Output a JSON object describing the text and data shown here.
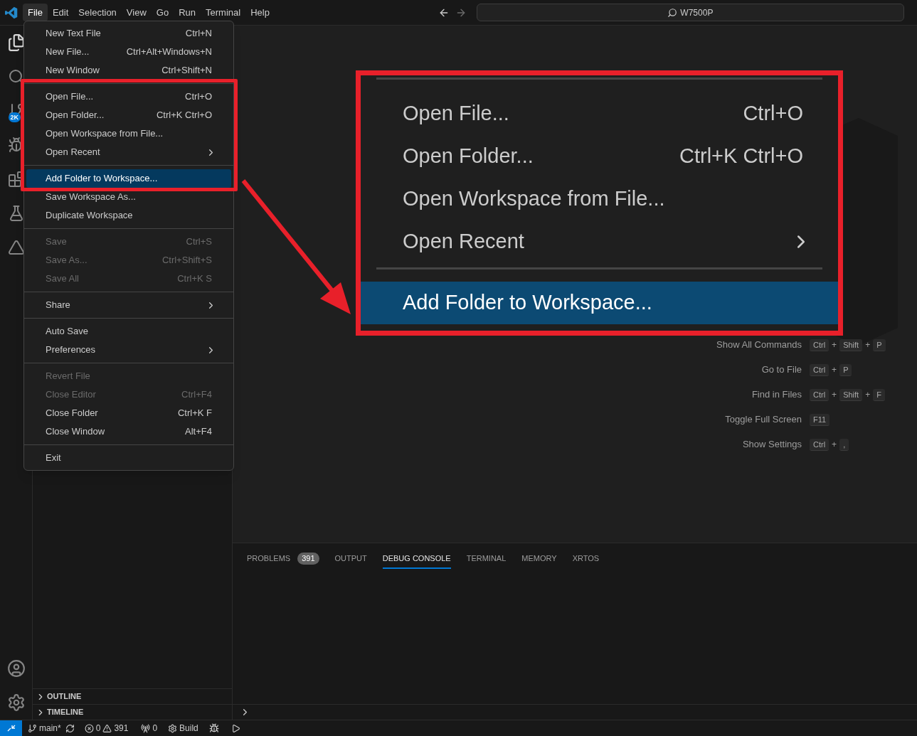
{
  "title_bar": {
    "menus": [
      {
        "label": "File",
        "selected": true
      },
      {
        "label": "Edit",
        "selected": false
      },
      {
        "label": "Selection",
        "selected": false
      },
      {
        "label": "View",
        "selected": false
      },
      {
        "label": "Go",
        "selected": false
      },
      {
        "label": "Run",
        "selected": false
      },
      {
        "label": "Terminal",
        "selected": false
      },
      {
        "label": "Help",
        "selected": false
      }
    ],
    "command_center": {
      "text": "W7500P"
    }
  },
  "activity_bar": {
    "source_control_badge": "2K"
  },
  "file_menu": {
    "groups": [
      [
        {
          "label": "New Text File",
          "shortcut": "Ctrl+N",
          "submenu": false,
          "disabled": false,
          "selected": false
        },
        {
          "label": "New File...",
          "shortcut": "Ctrl+Alt+Windows+N",
          "submenu": false,
          "disabled": false,
          "selected": false
        },
        {
          "label": "New Window",
          "shortcut": "Ctrl+Shift+N",
          "submenu": false,
          "disabled": false,
          "selected": false
        }
      ],
      [
        {
          "label": "Open File...",
          "shortcut": "Ctrl+O",
          "submenu": false,
          "disabled": false,
          "selected": false
        },
        {
          "label": "Open Folder...",
          "shortcut": "Ctrl+K Ctrl+O",
          "submenu": false,
          "disabled": false,
          "selected": false
        },
        {
          "label": "Open Workspace from File...",
          "submenu": false,
          "disabled": false,
          "selected": false
        },
        {
          "label": "Open Recent",
          "submenu": true,
          "disabled": false,
          "selected": false
        }
      ],
      [
        {
          "label": "Add Folder to Workspace...",
          "submenu": false,
          "disabled": false,
          "selected": true
        },
        {
          "label": "Save Workspace As...",
          "submenu": false,
          "disabled": false,
          "selected": false
        },
        {
          "label": "Duplicate Workspace",
          "submenu": false,
          "disabled": false,
          "selected": false
        }
      ],
      [
        {
          "label": "Save",
          "shortcut": "Ctrl+S",
          "submenu": false,
          "disabled": true,
          "selected": false
        },
        {
          "label": "Save As...",
          "shortcut": "Ctrl+Shift+S",
          "submenu": false,
          "disabled": true,
          "selected": false
        },
        {
          "label": "Save All",
          "shortcut": "Ctrl+K S",
          "submenu": false,
          "disabled": true,
          "selected": false
        }
      ],
      [
        {
          "label": "Share",
          "submenu": true,
          "disabled": false,
          "selected": false
        }
      ],
      [
        {
          "label": "Auto Save",
          "submenu": false,
          "disabled": false,
          "selected": false
        },
        {
          "label": "Preferences",
          "submenu": true,
          "disabled": false,
          "selected": false
        }
      ],
      [
        {
          "label": "Revert File",
          "submenu": false,
          "disabled": true,
          "selected": false
        },
        {
          "label": "Close Editor",
          "shortcut": "Ctrl+F4",
          "submenu": false,
          "disabled": true,
          "selected": false
        },
        {
          "label": "Close Folder",
          "shortcut": "Ctrl+K F",
          "submenu": false,
          "disabled": false,
          "selected": false
        },
        {
          "label": "Close Window",
          "shortcut": "Alt+F4",
          "submenu": false,
          "disabled": false,
          "selected": false
        }
      ],
      [
        {
          "label": "Exit",
          "submenu": false,
          "disabled": false,
          "selected": false
        }
      ]
    ]
  },
  "callout": {
    "groups": [
      [
        {
          "label": "Open File...",
          "shortcut": "Ctrl+O",
          "submenu": false,
          "selected": false
        },
        {
          "label": "Open Folder...",
          "shortcut": "Ctrl+K Ctrl+O",
          "submenu": false,
          "selected": false
        },
        {
          "label": "Open Workspace from File...",
          "submenu": false,
          "selected": false
        },
        {
          "label": "Open Recent",
          "submenu": true,
          "selected": false
        }
      ],
      [
        {
          "label": "Add Folder to Workspace...",
          "submenu": false,
          "selected": true
        }
      ]
    ]
  },
  "welcome_shortcuts": [
    {
      "label": "Show All Commands",
      "keys": [
        {
          "kind": "key",
          "text": "Ctrl"
        },
        {
          "kind": "plus",
          "text": "+"
        },
        {
          "kind": "key",
          "text": "Shift"
        },
        {
          "kind": "plus",
          "text": "+"
        },
        {
          "kind": "key",
          "text": "P"
        }
      ]
    },
    {
      "label": "Go to File",
      "keys": [
        {
          "kind": "key",
          "text": "Ctrl"
        },
        {
          "kind": "plus",
          "text": "+"
        },
        {
          "kind": "key",
          "text": "P"
        }
      ]
    },
    {
      "label": "Find in Files",
      "keys": [
        {
          "kind": "key",
          "text": "Ctrl"
        },
        {
          "kind": "plus",
          "text": "+"
        },
        {
          "kind": "key",
          "text": "Shift"
        },
        {
          "kind": "plus",
          "text": "+"
        },
        {
          "kind": "key",
          "text": "F"
        }
      ]
    },
    {
      "label": "Toggle Full Screen",
      "keys": [
        {
          "kind": "key",
          "text": "F11"
        }
      ]
    },
    {
      "label": "Show Settings",
      "keys": [
        {
          "kind": "key",
          "text": "Ctrl"
        },
        {
          "kind": "plus",
          "text": "+"
        },
        {
          "kind": "key",
          "text": ","
        }
      ]
    }
  ],
  "sidebar": {
    "sections": [
      {
        "label": "OUTLINE",
        "expanded": false
      },
      {
        "label": "TIMELINE",
        "expanded": false
      }
    ]
  },
  "panel": {
    "tabs": [
      {
        "label": "PROBLEMS",
        "badge": "391",
        "selected": false
      },
      {
        "label": "OUTPUT",
        "selected": false
      },
      {
        "label": "DEBUG CONSOLE",
        "selected": true
      },
      {
        "label": "TERMINAL",
        "selected": false
      },
      {
        "label": "MEMORY",
        "selected": false
      },
      {
        "label": "XRTOS",
        "selected": false
      }
    ]
  },
  "status_bar": {
    "branch": "main*",
    "errors": "0",
    "warnings": "391",
    "ports": "0",
    "build": "Build"
  }
}
